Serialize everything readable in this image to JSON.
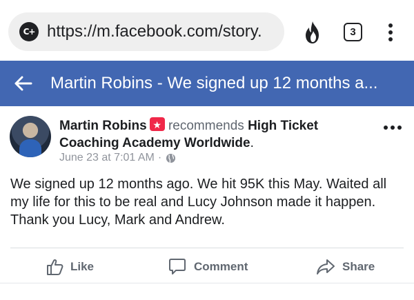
{
  "browser": {
    "site_icon_text": "C+",
    "url": "https://m.facebook.com/story.",
    "tab_count": "3",
    "icons": [
      "fire-icon",
      "tabs-icon",
      "menu-icon"
    ]
  },
  "header": {
    "title": "Martin Robins - We signed up 12 months a...",
    "background": "#4267b2"
  },
  "post": {
    "author": "Martin Robins",
    "verb": "recommends",
    "page_name": "High Ticket Coaching Academy Worldwide",
    "period": ".",
    "timestamp": "June 23 at 7:01 AM",
    "separator": "·",
    "body": "We signed up 12 months ago. We hit 95K this May. Waited all my life for this to be real and Lucy Johnson made it happen. Thank you Lucy, Mark and Andrew."
  },
  "actions": {
    "like": "Like",
    "comment": "Comment",
    "share": "Share"
  }
}
